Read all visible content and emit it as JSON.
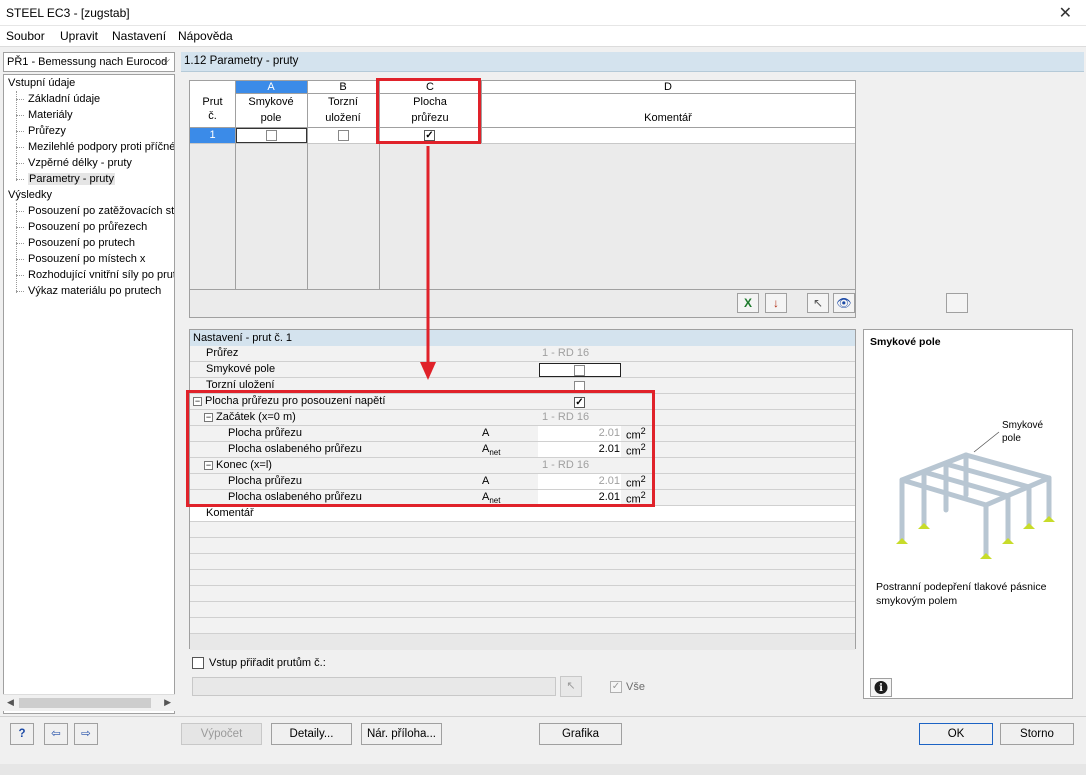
{
  "window": {
    "title": "STEEL EC3 - [zugstab]"
  },
  "menu": [
    "Soubor",
    "Upravit",
    "Nastavení",
    "Nápověda"
  ],
  "navigator": {
    "case_select": "PŘ1 - Bemessung nach Eurocod",
    "groups": [
      {
        "label": "Vstupní údaje",
        "items": [
          "Základní údaje",
          "Materiály",
          "Průřezy",
          "Mezilehlé podpory proti příčném",
          "Vzpěrné délky - pruty",
          "Parametry - pruty"
        ]
      },
      {
        "label": "Výsledky",
        "items": [
          "Posouzení po zatěžovacích stav",
          "Posouzení po průřezech",
          "Posouzení po prutech",
          "Posouzení po místech x",
          "Rozhodující vnitřní síly po prute",
          "Výkaz materiálu po prutech"
        ]
      }
    ]
  },
  "section_title": "1.12 Parametry - pruty",
  "table": {
    "col_letters": [
      "A",
      "B",
      "C",
      "D"
    ],
    "row_header": [
      "Prut",
      "č."
    ],
    "columns": [
      {
        "line1": "Smykové",
        "line2": "pole"
      },
      {
        "line1": "Torzní",
        "line2": "uložení"
      },
      {
        "line1": "Plocha",
        "line2": "průřezu"
      },
      {
        "line1": "",
        "line2": "Komentář"
      }
    ],
    "rows": [
      {
        "no": "1",
        "shear": false,
        "torsion": false,
        "area": true
      }
    ]
  },
  "settings": {
    "header": "Nastavení - prut č. 1",
    "rows": [
      {
        "label": "Průřez",
        "value": "1 - RD 16"
      },
      {
        "label": "Smykové pole",
        "checked": false
      },
      {
        "label": "Torzní uložení",
        "checked": false
      },
      {
        "label": "Plocha průřezu pro posouzení napětí",
        "checked": true
      },
      {
        "label": "Začátek (x=0 m)",
        "value": "1 - RD 16"
      },
      {
        "label": "Plocha průřezu",
        "symbol": "A",
        "value": "2.01",
        "unit": "cm",
        "unit_sup": "2"
      },
      {
        "label": "Plocha oslabeného průřezu",
        "symbol": "A",
        "symbol_sub": "net",
        "value": "2.01",
        "unit": "cm",
        "unit_sup": "2"
      },
      {
        "label": "Konec (x=l)",
        "value": "1 - RD 16"
      },
      {
        "label": "Plocha průřezu",
        "symbol": "A",
        "value": "2.01",
        "unit": "cm",
        "unit_sup": "2"
      },
      {
        "label": "Plocha oslabeného průřezu",
        "symbol": "A",
        "symbol_sub": "net",
        "value": "2.01",
        "unit": "cm",
        "unit_sup": "2"
      },
      {
        "label": "Komentář"
      }
    ],
    "assign_label": "Vstup přiřadit prutům č.:",
    "all_label": "Vše"
  },
  "info_panel": {
    "title": "Smykové pole",
    "callout": [
      "Smykové",
      "pole"
    ],
    "description": "Postranní podepření tlakové pásnice smykovým polem"
  },
  "buttons": {
    "calc": "Výpočet",
    "details": "Detaily...",
    "annex": "Nár. příloha...",
    "graphics": "Grafika",
    "ok": "OK",
    "cancel": "Storno"
  },
  "colors": {
    "highlight_red": "#e0222a",
    "header_blue": "#d4e3ee",
    "selected_blue": "#3b8be8"
  }
}
